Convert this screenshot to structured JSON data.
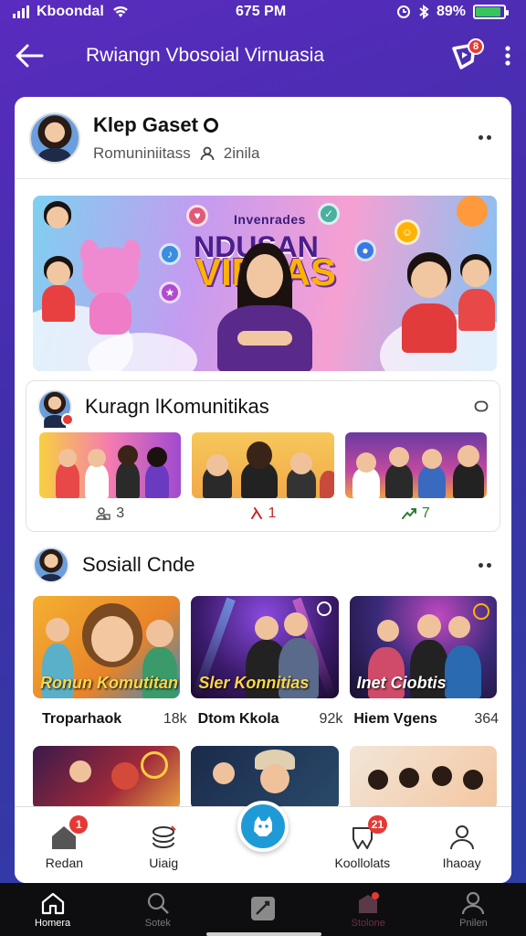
{
  "status_bar": {
    "carrier": "Kboondal",
    "time": "675 PM",
    "battery": "89%",
    "battery_level": 0.89
  },
  "header": {
    "title": "Rwiangn Vbosoial Virnuasia",
    "notification_count": "8"
  },
  "group": {
    "name": "Klep Gaset",
    "subtitle": "Romuniniitass",
    "member_count": "2inila"
  },
  "banner": {
    "small_title": "Invenrades",
    "title_line1": "NDUSAN",
    "title_line2": "VIRLAS"
  },
  "community": {
    "title": "Kuragn lKomunitikas",
    "items": [
      {
        "count": "3"
      },
      {
        "count": "1"
      },
      {
        "count": "7"
      }
    ]
  },
  "social": {
    "title": "Sosiall Cnde",
    "cards": [
      {
        "overlay": "Ronun Komutitan",
        "name": "Troparhaok",
        "stat": "18k"
      },
      {
        "overlay": "Sler Konnitias",
        "name": "Dtom Kkola",
        "stat": "92k"
      },
      {
        "overlay": "Inet Ciobtis",
        "name": "Hiem Vgens",
        "stat": "364"
      }
    ]
  },
  "inner_tabs": [
    {
      "label": "Redan",
      "badge": "1"
    },
    {
      "label": "Uiaig",
      "badge": ""
    },
    {
      "label": "",
      "badge": ""
    },
    {
      "label": "Koollolats",
      "badge": "21"
    },
    {
      "label": "Ihaoay",
      "badge": ""
    }
  ],
  "bottom_nav": [
    {
      "label": "Homera",
      "icon": "home-icon"
    },
    {
      "label": "Sotek",
      "icon": "search-icon"
    },
    {
      "label": "",
      "icon": "edit-icon"
    },
    {
      "label": "Stolone",
      "icon": "store-icon"
    },
    {
      "label": "Pnilen",
      "icon": "profile-icon"
    }
  ],
  "colors": {
    "background_top": "#5a2bbf",
    "background_bottom": "#2c3fa6",
    "accent": "#1e9bd7",
    "badge": "#e53935",
    "battery": "#35c759"
  }
}
